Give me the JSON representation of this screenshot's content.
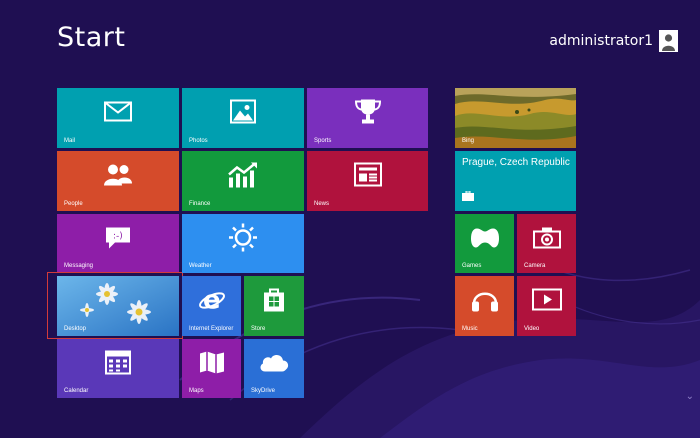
{
  "screen": {
    "title": "Start",
    "user_name": "administrator1"
  },
  "tiles": {
    "mail": {
      "label": "Mail",
      "color": "#00a0b0"
    },
    "photos": {
      "label": "Photos",
      "color": "#009fb0"
    },
    "sports": {
      "label": "Sports",
      "color": "#7a2fbd"
    },
    "people": {
      "label": "People",
      "color": "#d54b2b"
    },
    "finance": {
      "label": "Finance",
      "color": "#129a3d"
    },
    "news": {
      "label": "News",
      "color": "#b0123d"
    },
    "messaging": {
      "label": "Messaging",
      "color": "#8e1ea8"
    },
    "weather": {
      "label": "Weather",
      "color": "#2d8ff0"
    },
    "desktop": {
      "label": "Desktop",
      "color": "#3f8ed8"
    },
    "internet_explorer": {
      "label": "Internet Explorer",
      "color": "#2f6fdb"
    },
    "store": {
      "label": "Store",
      "color": "#1e9a3c"
    },
    "calendar": {
      "label": "Calendar",
      "color": "#5a38b8"
    },
    "maps": {
      "label": "Maps",
      "color": "#8e1ea8"
    },
    "skydrive": {
      "label": "SkyDrive",
      "color": "#2a6fd6"
    },
    "bing": {
      "label": "Bing",
      "color": "#8d7a2e"
    },
    "travel": {
      "label": "Prague, Czech Republic",
      "color": "#00a0b0"
    },
    "games": {
      "label": "Games",
      "color": "#129a3d"
    },
    "camera": {
      "label": "Camera",
      "color": "#b0123d"
    },
    "music": {
      "label": "Music",
      "color": "#d54b2b"
    },
    "video": {
      "label": "Video",
      "color": "#b0123d"
    }
  }
}
